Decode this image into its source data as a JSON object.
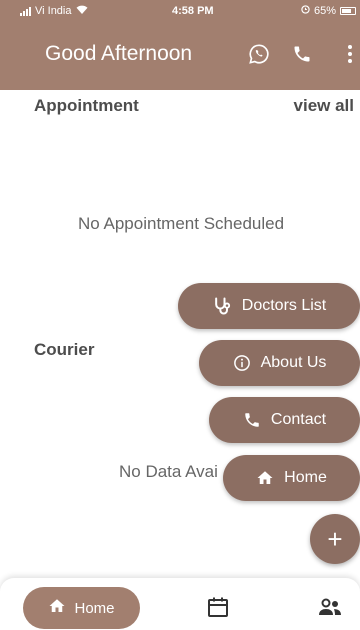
{
  "status_bar": {
    "carrier": "Vi India",
    "time": "4:58 PM",
    "battery": "65%"
  },
  "app_bar": {
    "title": "Good Afternoon",
    "icons": [
      "whatsapp-icon",
      "phone-icon",
      "more-vert-icon"
    ]
  },
  "appointment": {
    "title": "Appointment",
    "view_all": "view all",
    "empty_message": "No Appointment Scheduled"
  },
  "courier": {
    "title": "Courier",
    "empty_message": "No Data Avai"
  },
  "speed_dial": {
    "items": [
      {
        "label": "Doctors List",
        "icon": "stethoscope-icon"
      },
      {
        "label": "About Us",
        "icon": "info-icon"
      },
      {
        "label": "Contact",
        "icon": "phone-icon"
      },
      {
        "label": "Home",
        "icon": "home-icon"
      }
    ],
    "fab_icon": "plus-icon",
    "fab_symbol": "+"
  },
  "bottom_nav": {
    "items": [
      {
        "label": "Home",
        "icon": "home-icon",
        "active": true
      },
      {
        "label": "",
        "icon": "calendar-icon",
        "active": false
      },
      {
        "label": "",
        "icon": "people-icon",
        "active": false
      }
    ]
  },
  "colors": {
    "primary": "#a27f6f",
    "dial": "#8c6e62",
    "text_dark": "#4d4d4d",
    "text_muted": "#666666"
  }
}
